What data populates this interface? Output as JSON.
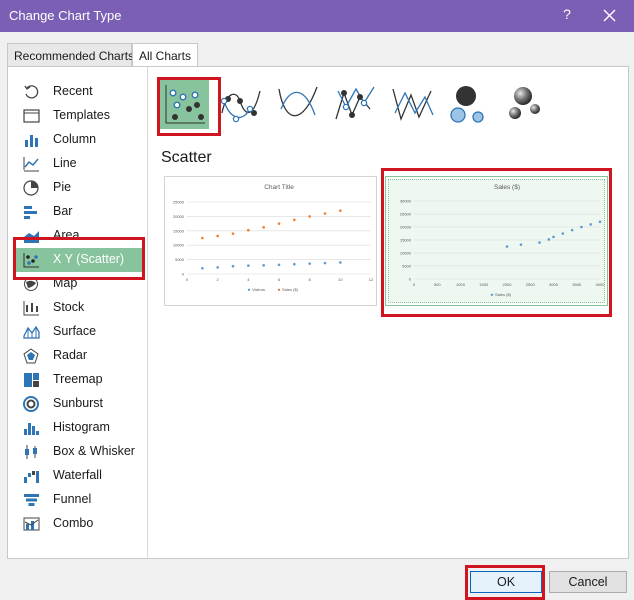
{
  "window": {
    "title": "Change Chart Type",
    "help_glyph": "?",
    "close_glyph": "✕"
  },
  "tabs": [
    {
      "label": "Recommended Charts"
    },
    {
      "label": "All Charts"
    }
  ],
  "sidebar": {
    "items": [
      {
        "label": "Recent",
        "icon": "recent-icon"
      },
      {
        "label": "Templates",
        "icon": "templates-icon"
      },
      {
        "label": "Column",
        "icon": "column-chart-icon"
      },
      {
        "label": "Line",
        "icon": "line-chart-icon"
      },
      {
        "label": "Pie",
        "icon": "pie-chart-icon"
      },
      {
        "label": "Bar",
        "icon": "bar-chart-icon"
      },
      {
        "label": "Area",
        "icon": "area-chart-icon"
      },
      {
        "label": "X Y (Scatter)",
        "icon": "scatter-chart-icon",
        "selected": true
      },
      {
        "label": "Map",
        "icon": "map-chart-icon"
      },
      {
        "label": "Stock",
        "icon": "stock-chart-icon"
      },
      {
        "label": "Surface",
        "icon": "surface-chart-icon"
      },
      {
        "label": "Radar",
        "icon": "radar-chart-icon"
      },
      {
        "label": "Treemap",
        "icon": "treemap-chart-icon"
      },
      {
        "label": "Sunburst",
        "icon": "sunburst-chart-icon"
      },
      {
        "label": "Histogram",
        "icon": "histogram-chart-icon"
      },
      {
        "label": "Box & Whisker",
        "icon": "box-whisker-chart-icon"
      },
      {
        "label": "Waterfall",
        "icon": "waterfall-chart-icon"
      },
      {
        "label": "Funnel",
        "icon": "funnel-chart-icon"
      },
      {
        "label": "Combo",
        "icon": "combo-chart-icon"
      }
    ]
  },
  "subtypes": [
    {
      "icon": "scatter-icon",
      "selected": true
    },
    {
      "icon": "scatter-smooth-lines-markers-icon"
    },
    {
      "icon": "scatter-smooth-lines-icon"
    },
    {
      "icon": "scatter-straight-lines-markers-icon"
    },
    {
      "icon": "scatter-straight-lines-icon"
    },
    {
      "icon": "bubble-icon"
    },
    {
      "icon": "3d-bubble-icon"
    }
  ],
  "selected_heading": "Scatter",
  "previews": {
    "left": {
      "title": "Chart Title",
      "y_ticks": [
        "0",
        "5000",
        "10000",
        "15000",
        "20000",
        "25000"
      ],
      "x_ticks": [
        "0",
        "2",
        "4",
        "6",
        "8",
        "10",
        "12"
      ],
      "legend": [
        "Visitors",
        "Sales ($)"
      ],
      "colors": {
        "visitors": "#5b9bd5",
        "sales": "#ed7d31"
      }
    },
    "right": {
      "title": "Sales ($)",
      "y_ticks": [
        "0",
        "5000",
        "10000",
        "15000",
        "20000",
        "25000",
        "30000"
      ],
      "x_ticks": [
        "0",
        "500",
        "1000",
        "1500",
        "2000",
        "2500",
        "3000",
        "3500",
        "4000"
      ],
      "legend": [
        "Sales ($)"
      ],
      "colors": {
        "sales": "#5b9bd5"
      }
    }
  },
  "chart_data": [
    {
      "type": "scatter",
      "title": "Chart Title",
      "xlim": [
        0,
        12
      ],
      "ylim": [
        0,
        25000
      ],
      "series": [
        {
          "name": "Visitors",
          "x": [
            1,
            2,
            3,
            4,
            5,
            6,
            7,
            8,
            9,
            10
          ],
          "y": [
            2000,
            2300,
            2700,
            2900,
            3000,
            3200,
            3400,
            3600,
            3800,
            4000
          ]
        },
        {
          "name": "Sales ($)",
          "x": [
            1,
            2,
            3,
            4,
            5,
            6,
            7,
            8,
            9,
            10
          ],
          "y": [
            12500,
            13200,
            14000,
            15200,
            16200,
            17500,
            18800,
            20000,
            21000,
            22000
          ]
        }
      ]
    },
    {
      "type": "scatter",
      "title": "Sales ($)",
      "xlim": [
        0,
        4000
      ],
      "ylim": [
        0,
        30000
      ],
      "series": [
        {
          "name": "Sales ($)",
          "x": [
            2000,
            2300,
            2700,
            2900,
            3000,
            3200,
            3400,
            3600,
            3800,
            4000
          ],
          "y": [
            12500,
            13200,
            14000,
            15200,
            16200,
            17500,
            18800,
            20000,
            21000,
            22000
          ]
        }
      ]
    }
  ],
  "buttons": {
    "ok": "OK",
    "cancel": "Cancel"
  }
}
